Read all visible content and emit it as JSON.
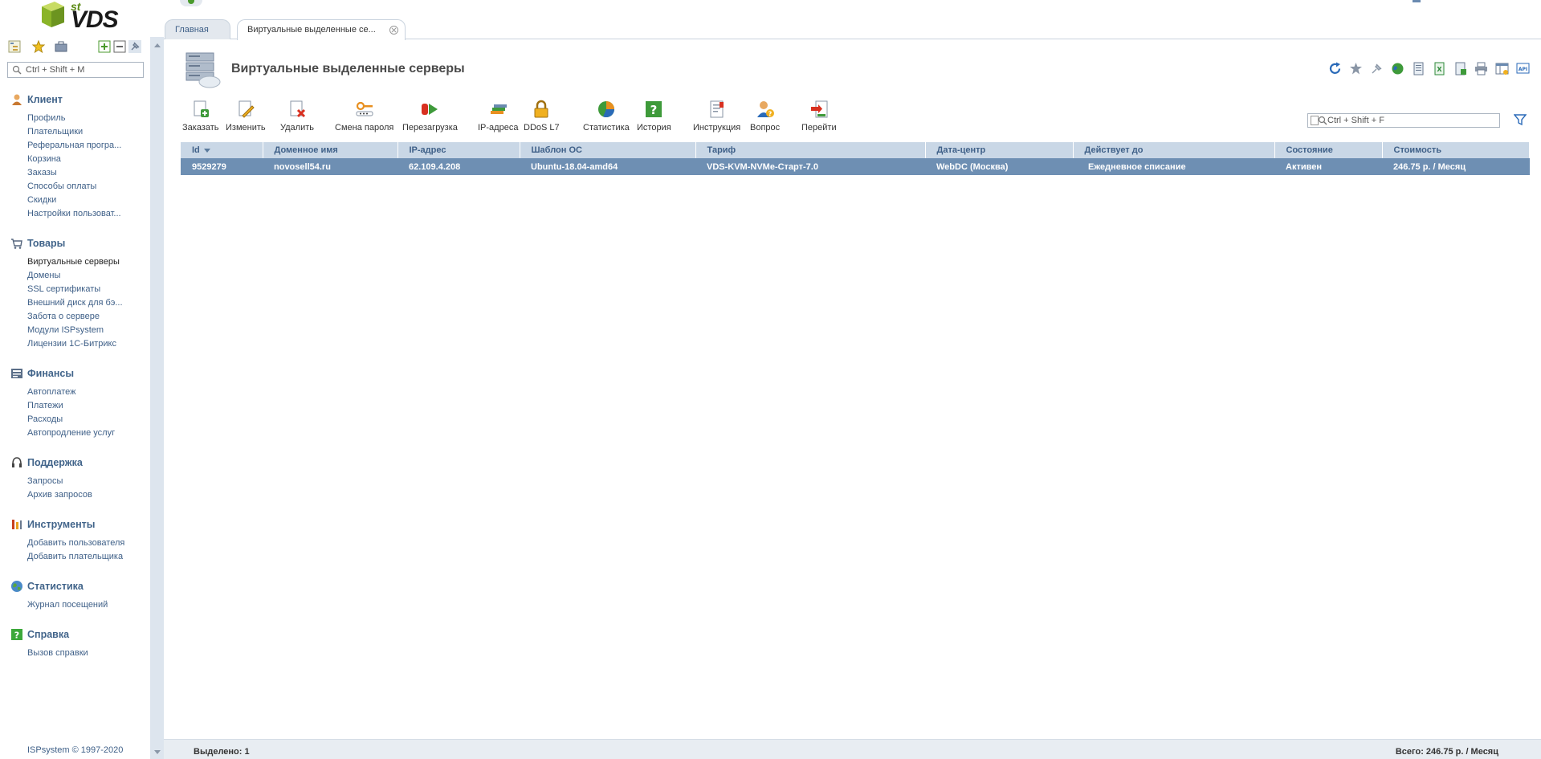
{
  "logo": {
    "sup": "st",
    "brand": "VDS"
  },
  "sidebar": {
    "search_placeholder": "Ctrl + Shift + M",
    "groups": [
      {
        "title": "Клиент",
        "items": [
          "Профиль",
          "Плательщики",
          "Реферальная програ...",
          "Корзина",
          "Заказы",
          "Способы оплаты",
          "Скидки",
          "Настройки пользоват..."
        ]
      },
      {
        "title": "Товары",
        "items": [
          "Виртуальные серверы",
          "Домены",
          "SSL сертификаты",
          "Внешний диск для бэ...",
          "Забота о сервере",
          "Модули ISPsystem",
          "Лицензии 1С-Битрикс"
        ]
      },
      {
        "title": "Финансы",
        "items": [
          "Автоплатеж",
          "Платежи",
          "Расходы",
          "Автопродление услуг"
        ]
      },
      {
        "title": "Поддержка",
        "items": [
          "Запросы",
          "Архив запросов"
        ]
      },
      {
        "title": "Инструменты",
        "items": [
          "Добавить пользователя",
          "Добавить плательщика"
        ]
      },
      {
        "title": "Статистика",
        "items": [
          "Журнал посещений"
        ]
      },
      {
        "title": "Справка",
        "items": [
          "Вызов справки"
        ]
      }
    ],
    "copyright": "ISPsystem © 1997-2020"
  },
  "tabs": {
    "home": "Главная",
    "current": "Виртуальные выделенные се..."
  },
  "page": {
    "title": "Виртуальные выделенные серверы"
  },
  "toolbar": [
    {
      "label": "Заказать",
      "icon": "order-icon"
    },
    {
      "label": "Изменить",
      "icon": "edit-icon"
    },
    {
      "label": "Удалить",
      "icon": "delete-icon"
    },
    {
      "label": "Смена пароля",
      "icon": "password-icon"
    },
    {
      "label": "Перезагрузка",
      "icon": "reboot-icon"
    },
    {
      "label": "IP-адреса",
      "icon": "ip-icon"
    },
    {
      "label": "DDoS L7",
      "icon": "lock-icon"
    },
    {
      "label": "Статистика",
      "icon": "pie-icon"
    },
    {
      "label": "История",
      "icon": "history-icon"
    },
    {
      "label": "Инструкция",
      "icon": "instruction-icon"
    },
    {
      "label": "Вопрос",
      "icon": "question-icon"
    },
    {
      "label": "Перейти",
      "icon": "goto-icon"
    }
  ],
  "list_search_placeholder": "Ctrl + Shift + F",
  "table": {
    "columns": [
      "Id",
      "Доменное имя",
      "IP-адрес",
      "Шаблон ОС",
      "Тариф",
      "Дата-центр",
      "Действует до",
      "Состояние",
      "Стоимость"
    ],
    "rows": [
      [
        "9529279",
        "novosell54.ru",
        "62.109.4.208",
        "Ubuntu-18.04-amd64",
        "VDS-KVM-NVMe-Старт-7.0",
        "WebDC (Москва)",
        "Ежедневное списание",
        "Активен",
        "246.75 р. / Месяц"
      ]
    ]
  },
  "status": {
    "selected": "Выделено: 1",
    "total": "Всего: 246.75 р. / Месяц"
  },
  "colors": {
    "accent": "#3f6088",
    "header_bg": "#c9d7e6",
    "selected_row": "#6e8fb3"
  }
}
